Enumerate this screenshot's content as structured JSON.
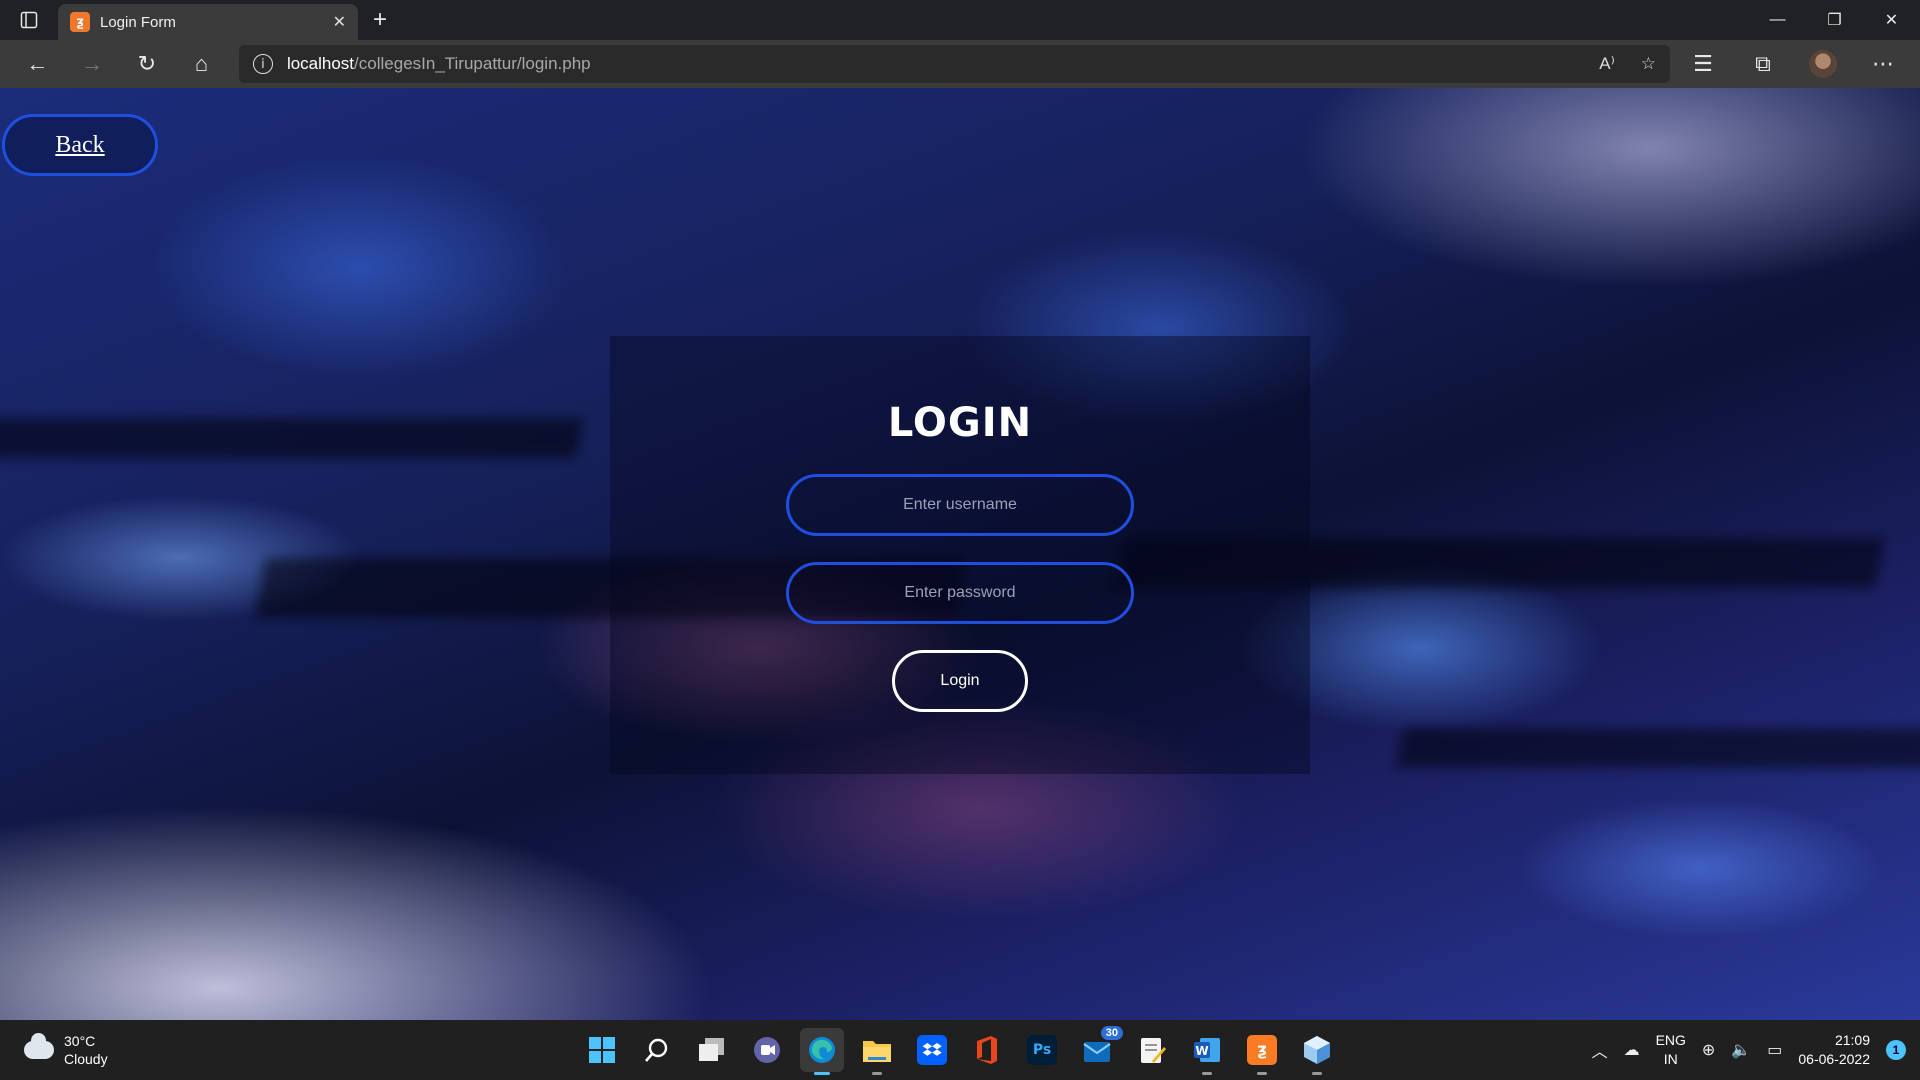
{
  "browser": {
    "tab_title": "Login Form",
    "url_host": "localhost",
    "url_path": "/collegesIn_Tirupattur/login.php"
  },
  "page": {
    "back_label": "Back",
    "login_title": "LOGIN",
    "username_placeholder": "Enter username",
    "password_placeholder": "Enter password",
    "login_button": "Login",
    "accent_color": "#1f4fe0"
  },
  "taskbar": {
    "weather_temp": "30°C",
    "weather_desc": "Cloudy",
    "mail_badge": "30",
    "lang_line1": "ENG",
    "lang_line2": "IN",
    "time": "21:09",
    "date": "06-06-2022",
    "notification_count": "1",
    "apps": [
      "start-icon",
      "search-icon",
      "task-view-icon",
      "teams-chat-icon",
      "edge-icon",
      "file-explorer-icon",
      "dropbox-icon",
      "office-icon",
      "photoshop-icon",
      "mail-icon",
      "notepad-icon",
      "word-icon",
      "xampp-icon",
      "virtualbox-icon"
    ]
  }
}
